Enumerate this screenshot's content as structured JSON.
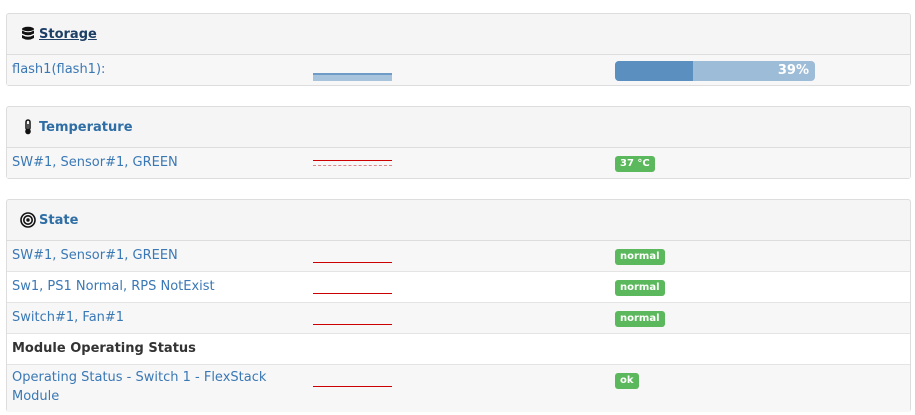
{
  "storage": {
    "title": "Storage",
    "icon": "database-icon",
    "rows": [
      {
        "label": "flash1(flash1):",
        "progress_percent": 39,
        "progress_text": "39%"
      }
    ]
  },
  "temperature": {
    "title": "Temperature",
    "icon": "thermometer-icon",
    "rows": [
      {
        "label": "SW#1, Sensor#1, GREEN",
        "badge": "37 °C"
      }
    ]
  },
  "state": {
    "title": "State",
    "icon": "target-icon",
    "rows": [
      {
        "label": "SW#1, Sensor#1, GREEN",
        "badge": "normal"
      },
      {
        "label": "Sw1, PS1 Normal, RPS NotExist",
        "badge": "normal"
      },
      {
        "label": "Switch#1, Fan#1",
        "badge": "normal"
      }
    ],
    "section_label": "Module Operating Status",
    "module_row": {
      "label": "Operating Status - Switch 1 - FlexStack Module",
      "badge": "ok"
    }
  },
  "colors": {
    "badge_green": "#5cb85c",
    "progress_fill": "#5b8fbf",
    "progress_track": "#9dbcd8",
    "spark_red": "#cc0000"
  }
}
